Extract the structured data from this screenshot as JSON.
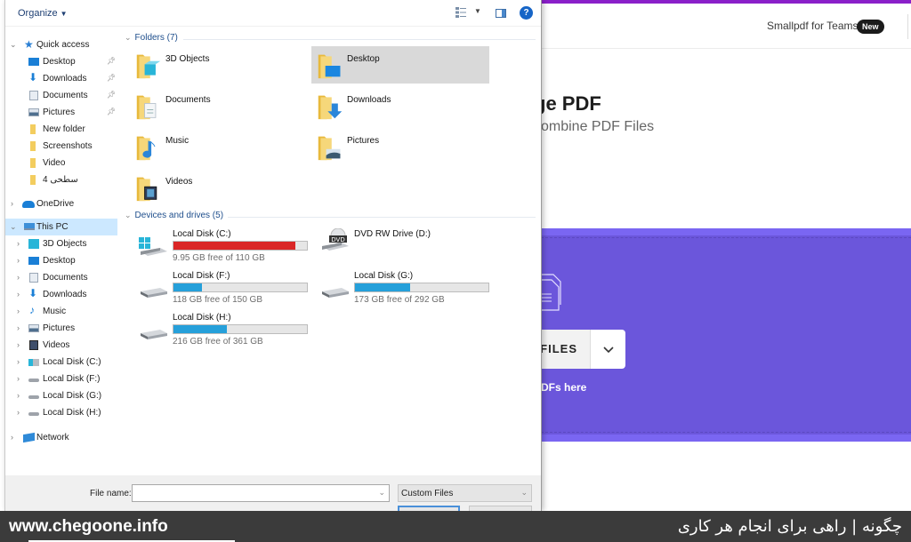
{
  "dialog": {
    "toolbar": {
      "organize_label": "Organize",
      "view_icon": "view-options-icon",
      "preview_icon": "preview-pane-icon",
      "help_icon": "help-icon",
      "help_glyph": "?"
    },
    "nav": {
      "quick_access": {
        "label": "Quick access",
        "items": [
          {
            "label": "Desktop",
            "icon": "desktop-icon",
            "pinned": true
          },
          {
            "label": "Downloads",
            "icon": "downloads-icon",
            "pinned": true
          },
          {
            "label": "Documents",
            "icon": "documents-icon",
            "pinned": true
          },
          {
            "label": "Pictures",
            "icon": "pictures-icon",
            "pinned": true
          },
          {
            "label": "New folder",
            "icon": "folder-icon",
            "pinned": false
          },
          {
            "label": "Screenshots",
            "icon": "folder-icon",
            "pinned": false
          },
          {
            "label": "Video",
            "icon": "folder-icon",
            "pinned": false
          },
          {
            "label": "سطحی 4",
            "icon": "folder-icon",
            "pinned": false
          }
        ]
      },
      "onedrive": {
        "label": "OneDrive"
      },
      "this_pc": {
        "label": "This PC",
        "items": [
          {
            "label": "3D Objects",
            "icon": "3d-objects-icon"
          },
          {
            "label": "Desktop",
            "icon": "desktop-icon"
          },
          {
            "label": "Documents",
            "icon": "documents-icon"
          },
          {
            "label": "Downloads",
            "icon": "downloads-icon"
          },
          {
            "label": "Music",
            "icon": "music-icon"
          },
          {
            "label": "Pictures",
            "icon": "pictures-icon"
          },
          {
            "label": "Videos",
            "icon": "videos-icon"
          },
          {
            "label": "Local Disk (C:)",
            "icon": "windows-drive-icon"
          },
          {
            "label": "Local Disk (F:)",
            "icon": "drive-icon"
          },
          {
            "label": "Local Disk (G:)",
            "icon": "drive-icon"
          },
          {
            "label": "Local Disk (H:)",
            "icon": "drive-icon"
          }
        ]
      },
      "network": {
        "label": "Network"
      }
    },
    "content": {
      "folders_header": "Folders (7)",
      "folders": [
        {
          "label": "3D Objects",
          "badge": "3d"
        },
        {
          "label": "Desktop",
          "badge": "desktop",
          "selected": true
        },
        {
          "label": "Documents",
          "badge": "documents"
        },
        {
          "label": "Downloads",
          "badge": "downloads"
        },
        {
          "label": "Music",
          "badge": "music"
        },
        {
          "label": "Pictures",
          "badge": "pictures"
        },
        {
          "label": "Videos",
          "badge": "videos"
        }
      ],
      "drives_header": "Devices and drives (5)",
      "drives": [
        {
          "label": "Local Disk (C:)",
          "free_text": "9.95 GB free of 110 GB",
          "used_fraction": 0.91,
          "critical": true,
          "kind": "windows"
        },
        {
          "label": "DVD RW Drive (D:)",
          "kind": "dvd"
        },
        {
          "label": "Local Disk (F:)",
          "free_text": "118 GB free of 150 GB",
          "used_fraction": 0.21,
          "critical": false,
          "kind": "hdd"
        },
        {
          "label": "Local Disk (G:)",
          "free_text": "173 GB free of 292 GB",
          "used_fraction": 0.41,
          "critical": false,
          "kind": "hdd"
        },
        {
          "label": "Local Disk (H:)",
          "free_text": "216 GB free of 361 GB",
          "used_fraction": 0.4,
          "critical": false,
          "kind": "hdd"
        }
      ]
    },
    "footer": {
      "file_name_label": "File name:",
      "file_name_value": "",
      "file_type_value": "Custom Files"
    }
  },
  "web": {
    "teams_link": "Smallpdf for Teams",
    "new_badge": "New",
    "hero_title": "ge PDF",
    "hero_subtitle": "combine PDF Files",
    "choose_files_label": "FILES",
    "choose_caret": "⌄",
    "drop_text": "DFs here",
    "colors": {
      "topbar": "#8a1fc9",
      "dropzone": "#6b56db"
    }
  },
  "watermark": {
    "url": "www.chegoone.info",
    "tagline": "چگونه | راهی برای انجام هر کاری"
  }
}
